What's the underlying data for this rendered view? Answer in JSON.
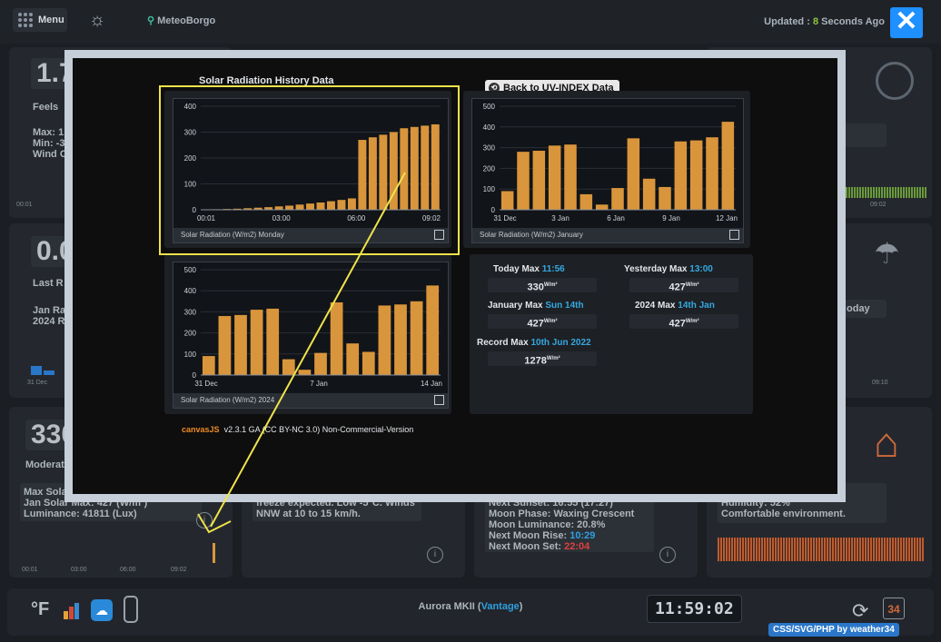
{
  "topbar": {
    "menu_label": "Menu",
    "station": "MeteoBorgo",
    "updated_prefix": "Updated : ",
    "updated_n": "8",
    "updated_suffix": " Seconds Ago"
  },
  "background_cards": {
    "temp_val": "1.7",
    "feels": "Feels",
    "max": "Max: 1",
    "min": "Min: -3",
    "wind": "Wind C",
    "rain_val": "0.0",
    "last_r": "Last R",
    "jan_r": "Jan Ra",
    "year_r": "2024 R",
    "solar_val": "330",
    "moderate": "Moderate",
    "max_solar": "Max Solar",
    "jan_solar": "Jan Solar Max: 427 (W/m²)",
    "luminance": "Luminance: 41811 (Lux)",
    "freeze": "freeze expected. Low -5°C. Winds",
    "nnw": "NNW at 10 to 15 km/h.",
    "next_sunset": "Next Sunset: 16:55 (17:27)",
    "moon_phase": "Moon Phase: Waxing Crescent",
    "moon_lum": "Moon Luminance: 20.8%",
    "moon_rise_lbl": "Next Moon Rise: ",
    "moon_rise_val": "10:29",
    "moon_set_lbl": "Next Moon Set: ",
    "moon_set_val": "22:04",
    "humidity": "Humidity: 52%",
    "comfortable": "Comfortable environment.",
    "today": "oday",
    "ticks_a": [
      "00:01",
      "03:00",
      "06:00",
      "09:02"
    ],
    "tick_0902": "09:02",
    "tick_3jan": "31 Dec",
    "tick_0910": "09:10"
  },
  "bottombar": {
    "unit": "°F",
    "aurora_prefix": "Aurora MKII (",
    "aurora_v": "Vantage",
    "aurora_suffix": ")",
    "clock": "11:59:02",
    "calendar_day": "34",
    "credit": "CSS/SVG/PHP by weather34"
  },
  "modal": {
    "title": "Solar Radiation History Data",
    "back_label": "Back to UV-INDEX Data",
    "canvasjs_logo": "canvasJS",
    "canvasjs_text": "v2.3.1 GA (CC BY-NC 3.0) Non-Commercial-Version",
    "stats": {
      "today_lbl": "Today Max ",
      "today_time": "11:56",
      "today_val": "330",
      "yesterday_lbl": "Yesterday Max ",
      "yesterday_time": "13:00",
      "yesterday_val": "427",
      "jan_lbl": "January Max ",
      "jan_time": "Sun 14th",
      "jan_val": "427",
      "year_lbl": "2024 Max ",
      "year_time": "14th Jan",
      "year_val": "427",
      "record_lbl": "Record Max ",
      "record_time": "10th Jun 2022",
      "record_val": "1278",
      "unit": "W/m²"
    }
  },
  "chart_data": [
    {
      "type": "bar",
      "title": "Solar Radiation (W/m2) Monday",
      "ylim": [
        0,
        400
      ],
      "yticks": [
        "0",
        "100",
        "200",
        "300",
        "400"
      ],
      "xticks": [
        "00:01",
        "03:00",
        "06:00",
        "09:02"
      ],
      "values": [
        1,
        2,
        3,
        4,
        6,
        8,
        10,
        13,
        16,
        20,
        24,
        28,
        33,
        38,
        44,
        270,
        280,
        290,
        300,
        315,
        320,
        325,
        330
      ]
    },
    {
      "type": "bar",
      "title": "Solar Radiation (W/m2) January",
      "ylim": [
        0,
        500
      ],
      "yticks": [
        "0",
        "100",
        "200",
        "300",
        "400",
        "500"
      ],
      "xticks": [
        "31 Dec",
        "3 Jan",
        "6 Jan",
        "9 Jan",
        "12 Jan"
      ],
      "values": [
        90,
        280,
        285,
        310,
        315,
        75,
        25,
        105,
        345,
        150,
        110,
        330,
        335,
        350,
        425
      ]
    },
    {
      "type": "bar",
      "title": "Solar Radiation (W/m2) 2024",
      "ylim": [
        0,
        500
      ],
      "yticks": [
        "0",
        "100",
        "200",
        "300",
        "400",
        "500"
      ],
      "xticks": [
        "31 Dec",
        "7 Jan",
        "14 Jan"
      ],
      "values": [
        90,
        280,
        285,
        310,
        315,
        75,
        25,
        105,
        345,
        150,
        110,
        330,
        335,
        350,
        425
      ]
    }
  ],
  "colors": {
    "bar": "#d9953b",
    "accent": "#35a8e0",
    "highlight": "#f0e34a"
  }
}
